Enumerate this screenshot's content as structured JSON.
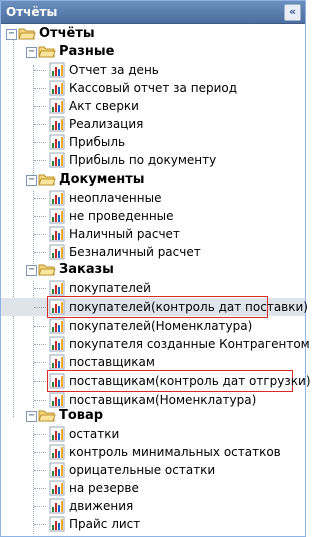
{
  "panel": {
    "title": "Отчёты",
    "collapse_symbol": "«"
  },
  "tree": {
    "root": {
      "label": "Отчёты"
    },
    "groups": [
      {
        "label": "Разные",
        "items": [
          {
            "label": "Отчет за день"
          },
          {
            "label": "Кассовый отчет за период"
          },
          {
            "label": "Акт сверки"
          },
          {
            "label": "Реализация"
          },
          {
            "label": "Прибыль"
          },
          {
            "label": "Прибыль по документу"
          }
        ]
      },
      {
        "label": "Документы",
        "items": [
          {
            "label": "неоплаченные"
          },
          {
            "label": "не проведенные"
          },
          {
            "label": "Наличный расчет"
          },
          {
            "label": "Безналичный расчет"
          }
        ]
      },
      {
        "label": "Заказы",
        "items": [
          {
            "label": "покупателей"
          },
          {
            "label": "покупателей(контроль дат поставки)"
          },
          {
            "label": "покупателей(Номенклатура)"
          },
          {
            "label": "покупателя созданные Контрагентом"
          },
          {
            "label": "поставщикам"
          },
          {
            "label": "поставщикам(контроль дат отгрузки)"
          },
          {
            "label": "поставщикам(Номенклатура)"
          }
        ]
      },
      {
        "label": "Товар",
        "items": [
          {
            "label": "остатки"
          },
          {
            "label": "контроль минимальных остатков"
          },
          {
            "label": "орицательные остатки"
          },
          {
            "label": "на резерве"
          },
          {
            "label": "движения"
          },
          {
            "label": "Прайс лист"
          }
        ]
      }
    ]
  },
  "colors": {
    "header": "#5a7eb0",
    "selection": "#dfe3ea",
    "highlight_border": "#d92a2a",
    "folder": "#f2c94c"
  }
}
